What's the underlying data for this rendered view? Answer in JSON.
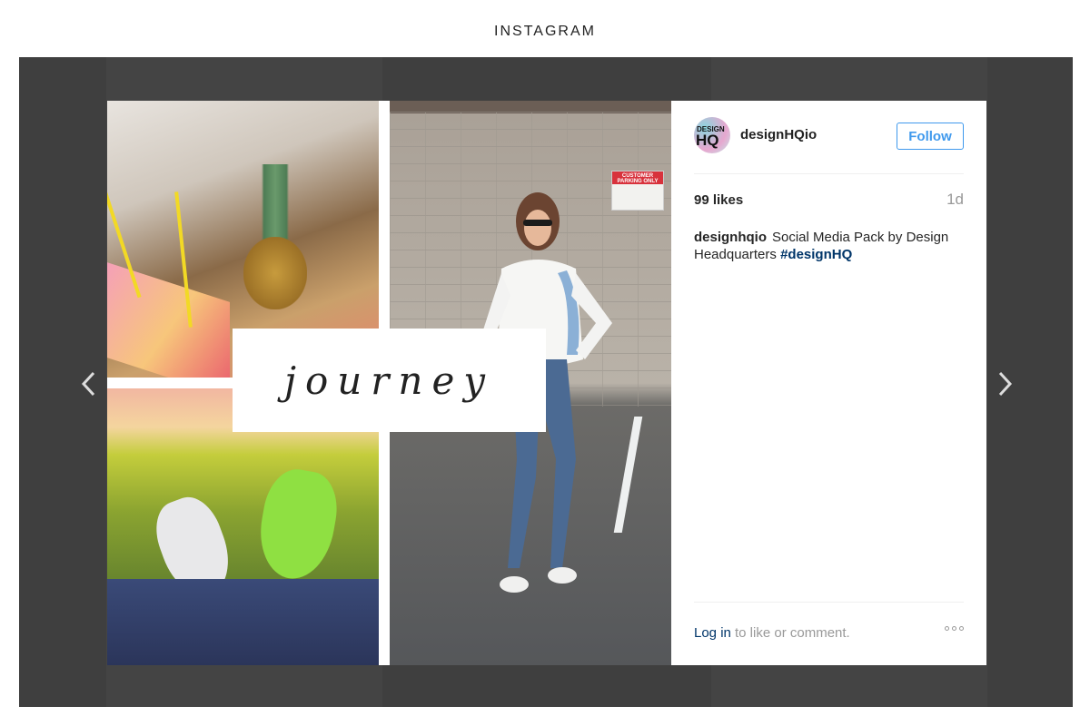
{
  "page": {
    "heading": "INSTAGRAM"
  },
  "navigation": {
    "prev_icon": "chevron-left-icon",
    "next_icon": "chevron-right-icon"
  },
  "post": {
    "image_overlay_text": "journey",
    "author": {
      "username": "designHQio",
      "avatar_text_top": "DESIGN",
      "avatar_text_bottom": "HQ"
    },
    "follow_label": "Follow",
    "likes": "99 likes",
    "age": "1d",
    "caption": {
      "user": "designhqio",
      "text": "Social Media Pack by Design Headquarters",
      "hashtag": "#designHQ"
    },
    "parking_sign": "CUSTOMER PARKING ONLY",
    "footer": {
      "login_link": "Log in",
      "login_rest": "to like or comment."
    }
  },
  "colors": {
    "link": "#003569",
    "follow": "#3f99ed",
    "overlay": "#3f3f3f"
  }
}
